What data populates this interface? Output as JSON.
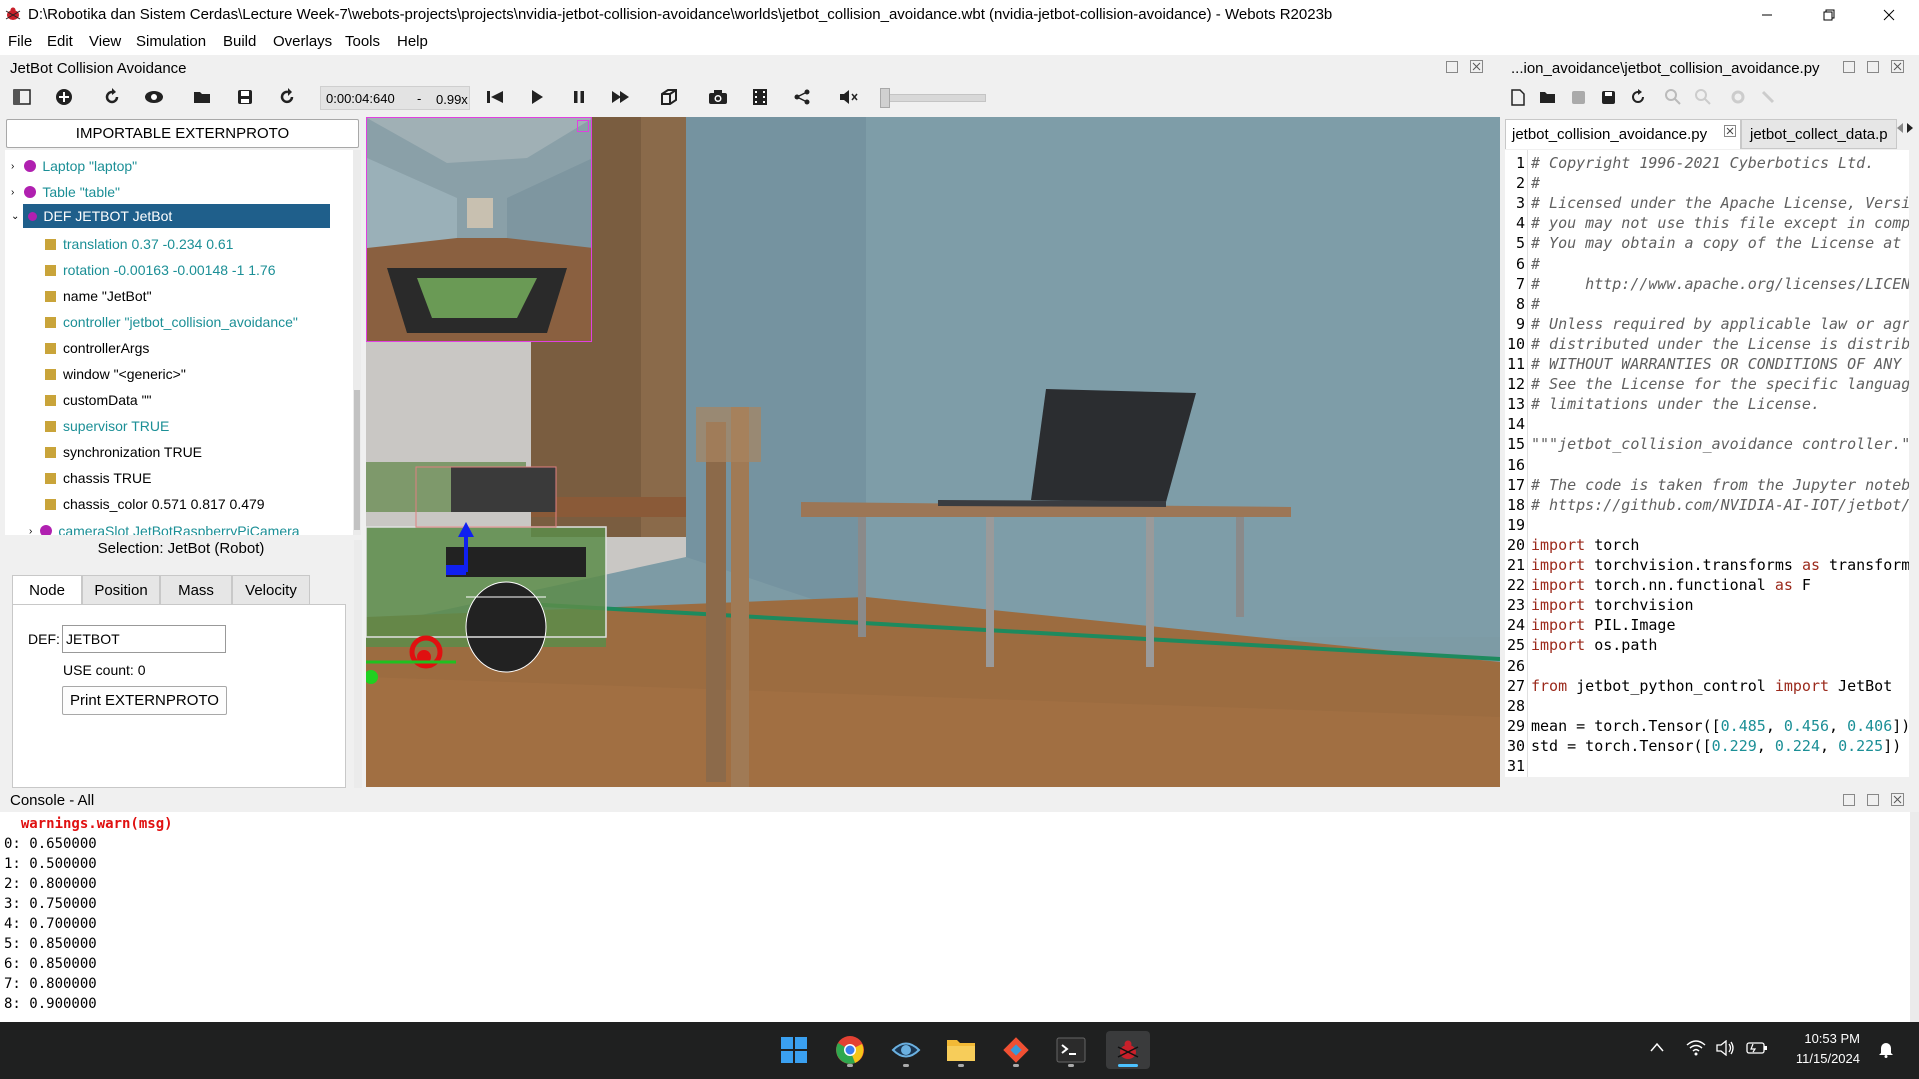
{
  "window": {
    "title": "D:\\Robotika dan Sistem Cerdas\\Lecture Week-7\\webots-projects\\projects\\nvidia-jetbot-collision-avoidance\\worlds\\jetbot_collision_avoidance.wbt (nvidia-jetbot-collision-avoidance) - Webots R2023b"
  },
  "menu": [
    "File",
    "Edit",
    "View",
    "Simulation",
    "Build",
    "Overlays",
    "Tools",
    "Help"
  ],
  "view3d": {
    "title": "JetBot Collision Avoidance",
    "time": "0:00:04:640",
    "speed_dash": "-",
    "speed": "0.99x"
  },
  "scene_tree": {
    "header_button": "IMPORTABLE EXTERNPROTO",
    "nodes": [
      {
        "label": "Laptop \"laptop\""
      },
      {
        "label": "Table \"table\""
      },
      {
        "label": "DEF JETBOT JetBot"
      }
    ],
    "fields": [
      {
        "label": "translation 0.37 -0.234 0.61"
      },
      {
        "label": "rotation -0.00163 -0.00148 -1 1.76"
      },
      {
        "label": "name \"JetBot\""
      },
      {
        "label": "controller \"jetbot_collision_avoidance\""
      },
      {
        "label": "controllerArgs"
      },
      {
        "label": "window \"<generic>\""
      },
      {
        "label": "customData \"\""
      },
      {
        "label": "supervisor TRUE"
      },
      {
        "label": "synchronization TRUE"
      },
      {
        "label": "chassis TRUE"
      },
      {
        "label": "chassis_color 0.571 0.817 0.479"
      },
      {
        "label": "cameraSlot JetBotRaspberryPiCamera"
      }
    ]
  },
  "node_panel": {
    "selection": "Selection: JetBot (Robot)",
    "tabs": [
      "Node",
      "Position",
      "Mass",
      "Velocity"
    ],
    "def_label": "DEF:",
    "def_value": "JETBOT",
    "use_count": "USE count: 0",
    "print_button": "Print EXTERNPROTO"
  },
  "editor": {
    "title": "...ion_avoidance\\jetbot_collision_avoidance.py",
    "tabs": [
      "jetbot_collision_avoidance.py",
      "jetbot_collect_data.p"
    ],
    "lines": [
      {
        "n": "1",
        "text": "# Copyright 1996-2021 Cyberbotics Ltd."
      },
      {
        "n": "2",
        "text": "#"
      },
      {
        "n": "3",
        "text": "# Licensed under the Apache License, Versi"
      },
      {
        "n": "4",
        "text": "# you may not use this file except in comp"
      },
      {
        "n": "5",
        "text": "# You may obtain a copy of the License at"
      },
      {
        "n": "6",
        "text": "#"
      },
      {
        "n": "7",
        "text": "#     http://www.apache.org/licenses/LICEN"
      },
      {
        "n": "8",
        "text": "#"
      },
      {
        "n": "9",
        "text": "# Unless required by applicable law or agr"
      },
      {
        "n": "10",
        "text": "# distributed under the License is distrib"
      },
      {
        "n": "11",
        "text": "# WITHOUT WARRANTIES OR CONDITIONS OF ANY "
      },
      {
        "n": "12",
        "text": "# See the License for the specific languag"
      },
      {
        "n": "13",
        "text": "# limitations under the License."
      },
      {
        "n": "14",
        "text": ""
      },
      {
        "n": "15",
        "text": "\"\"\"jetbot_collision_avoidance controller.\""
      },
      {
        "n": "16",
        "text": ""
      },
      {
        "n": "17",
        "text": "# The code is taken from the Jupyter noteb"
      },
      {
        "n": "18",
        "text": "# https://github.com/NVIDIA-AI-IOT/jetbot/"
      },
      {
        "n": "19",
        "text": ""
      },
      {
        "n": "20",
        "text": "import torch"
      },
      {
        "n": "21",
        "text": "import torchvision.transforms as transform"
      },
      {
        "n": "22",
        "text": "import torch.nn.functional as F"
      },
      {
        "n": "23",
        "text": "import torchvision"
      },
      {
        "n": "24",
        "text": "import PIL.Image"
      },
      {
        "n": "25",
        "text": "import os.path"
      },
      {
        "n": "26",
        "text": ""
      },
      {
        "n": "27",
        "text": "from jetbot_python_control import JetBot"
      },
      {
        "n": "28",
        "text": ""
      },
      {
        "n": "29",
        "text": "mean = torch.Tensor([0.485, 0.456, 0.406])"
      },
      {
        "n": "30",
        "text": "std = torch.Tensor([0.229, 0.224, 0.225])"
      },
      {
        "n": "31",
        "text": ""
      }
    ]
  },
  "console": {
    "title": "Console - All",
    "warning": "  warnings.warn(msg)",
    "lines": [
      "0: 0.650000",
      "1: 0.500000",
      "2: 0.800000",
      "3: 0.750000",
      "4: 0.700000",
      "5: 0.850000",
      "6: 0.850000",
      "7: 0.800000",
      "8: 0.900000"
    ]
  },
  "taskbar": {
    "time": "10:53 PM",
    "date": "11/15/2024"
  },
  "colors": {
    "selection_bg": "#1f5f8b",
    "field_teal": "#1b8f96",
    "keyword": "#9b2a1c",
    "warning_red": "#e01010",
    "taskbar": "#1f2020"
  }
}
